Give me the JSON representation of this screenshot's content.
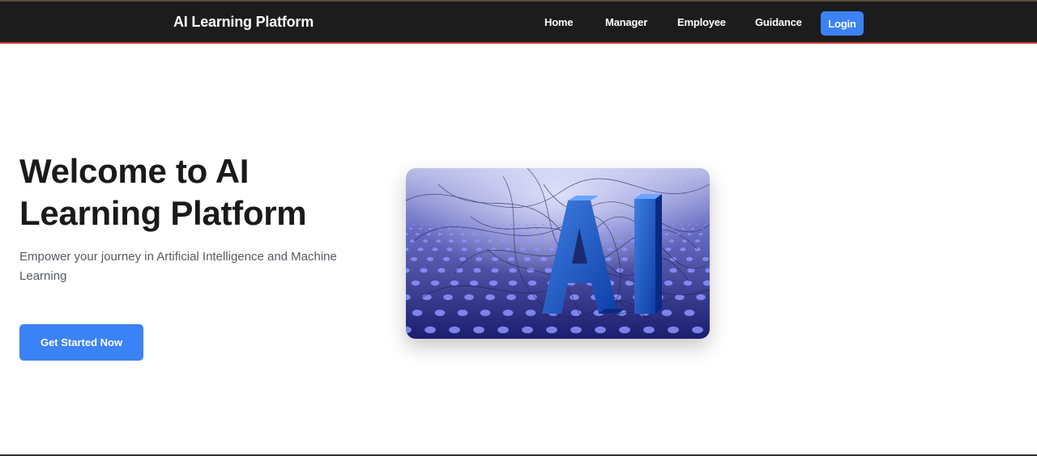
{
  "nav": {
    "brand": "AI Learning Platform",
    "links": [
      "Home",
      "Manager",
      "Employee",
      "Guidance"
    ],
    "login_label": "Login"
  },
  "hero": {
    "title": "Welcome to AI Learning Platform",
    "subtitle": "Empower your journey in Artificial Intelligence and Machine Learning",
    "cta_label": "Get Started Now",
    "image_alt": "AI"
  },
  "colors": {
    "navbar_bg": "#1c1c1c",
    "accent": "#3b82f6",
    "heading": "#1a1a1a",
    "body_text": "#555a63"
  }
}
